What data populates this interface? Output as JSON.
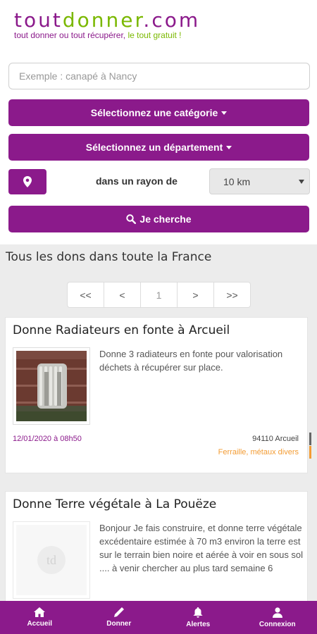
{
  "brand": {
    "part1": "tout",
    "part2": "donner",
    "part3": ".com",
    "tagline_main": "tout donner ou tout récupérer,",
    "tagline_green": "le tout gratuit !"
  },
  "search": {
    "placeholder": "Exemple : canapé à Nancy"
  },
  "filters": {
    "category_label": "Sélectionnez une catégorie",
    "department_label": "Sélectionnez un département",
    "radius_label": "dans un rayon de",
    "radius_value": "10 km",
    "search_button": "Je cherche"
  },
  "section_title": "Tous les dons dans toute la France",
  "pagination": {
    "first": "<<",
    "prev": "<",
    "current": "1",
    "next": ">",
    "last": ">>"
  },
  "listings": [
    {
      "title": "Donne Radiateurs en fonte à Arcueil",
      "description": "Donne 3 radiateurs en fonte pour valorisation déchets à récupérer sur place.",
      "date": "12/01/2020 à 08h50",
      "location": "94110 Arcueil",
      "category": "Ferraille, métaux divers"
    },
    {
      "title": "Donne Terre végétale à La Pouëze",
      "description": "Bonjour Je fais construire, et donne terre végétale excédentaire estimée à 70 m3 environ la terre est sur le terrain bien noire et aérée à voir en sous sol .... à venir chercher au plus tard semaine 6"
    }
  ],
  "tabs": [
    "Accueil",
    "Donner",
    "Alertes",
    "Connexion"
  ],
  "colors": {
    "brand_purple": "#8b1a8b",
    "brand_green": "#7ab800",
    "category_orange": "#f39c34"
  },
  "icons": {
    "location": "map-marker-icon",
    "search": "magnifier-icon",
    "home": "home-icon",
    "donate": "pencil-icon",
    "alerts": "bell-icon",
    "login": "user-icon"
  }
}
